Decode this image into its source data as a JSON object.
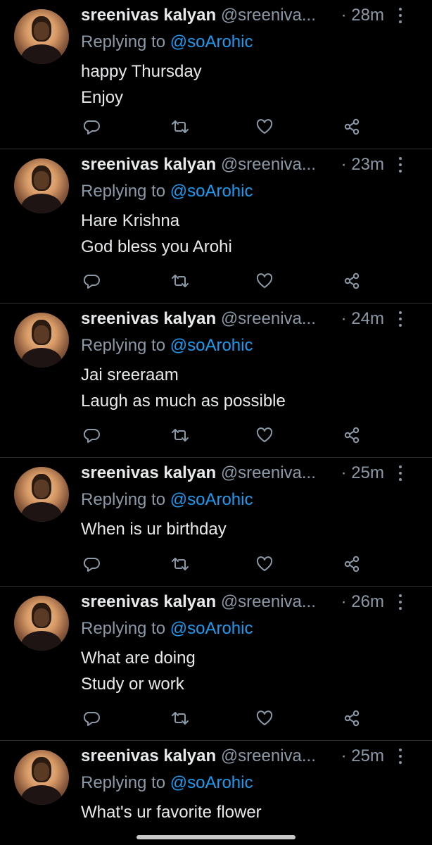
{
  "tweets": [
    {
      "name": "sreenivas kalyan",
      "handle": "@sreeniva...",
      "time": "· 28m",
      "replying_prefix": "Replying to",
      "replying_to": "@soArohic",
      "lines": [
        "happy Thursday",
        "Enjoy"
      ]
    },
    {
      "name": "sreenivas kalyan",
      "handle": "@sreeniva...",
      "time": "· 23m",
      "replying_prefix": "Replying to",
      "replying_to": "@soArohic",
      "lines": [
        "Hare Krishna",
        "God bless you Arohi"
      ]
    },
    {
      "name": "sreenivas kalyan",
      "handle": "@sreeniva...",
      "time": "· 24m",
      "replying_prefix": "Replying to",
      "replying_to": "@soArohic",
      "lines": [
        "Jai sreeraam",
        "Laugh as much as possible"
      ]
    },
    {
      "name": "sreenivas kalyan",
      "handle": "@sreeniva...",
      "time": "· 25m",
      "replying_prefix": "Replying to",
      "replying_to": "@soArohic",
      "lines": [
        "When is ur birthday"
      ]
    },
    {
      "name": "sreenivas kalyan",
      "handle": "@sreeniva...",
      "time": "· 26m",
      "replying_prefix": "Replying to",
      "replying_to": "@soArohic",
      "lines": [
        "What are doing",
        "Study or work"
      ]
    },
    {
      "name": "sreenivas kalyan",
      "handle": "@sreeniva...",
      "time": "· 25m",
      "replying_prefix": "Replying to",
      "replying_to": "@soArohic",
      "lines": [
        "What's ur favorite flower"
      ]
    }
  ],
  "icons": {
    "reply": "reply-icon",
    "retweet": "retweet-icon",
    "like": "like-icon",
    "share": "share-icon",
    "more": "more-vertical-icon"
  },
  "colors": {
    "background": "#000000",
    "text": "#e7e9ea",
    "muted": "#8b98a5",
    "link": "#1d9bf0",
    "divider": "#2f3336"
  }
}
